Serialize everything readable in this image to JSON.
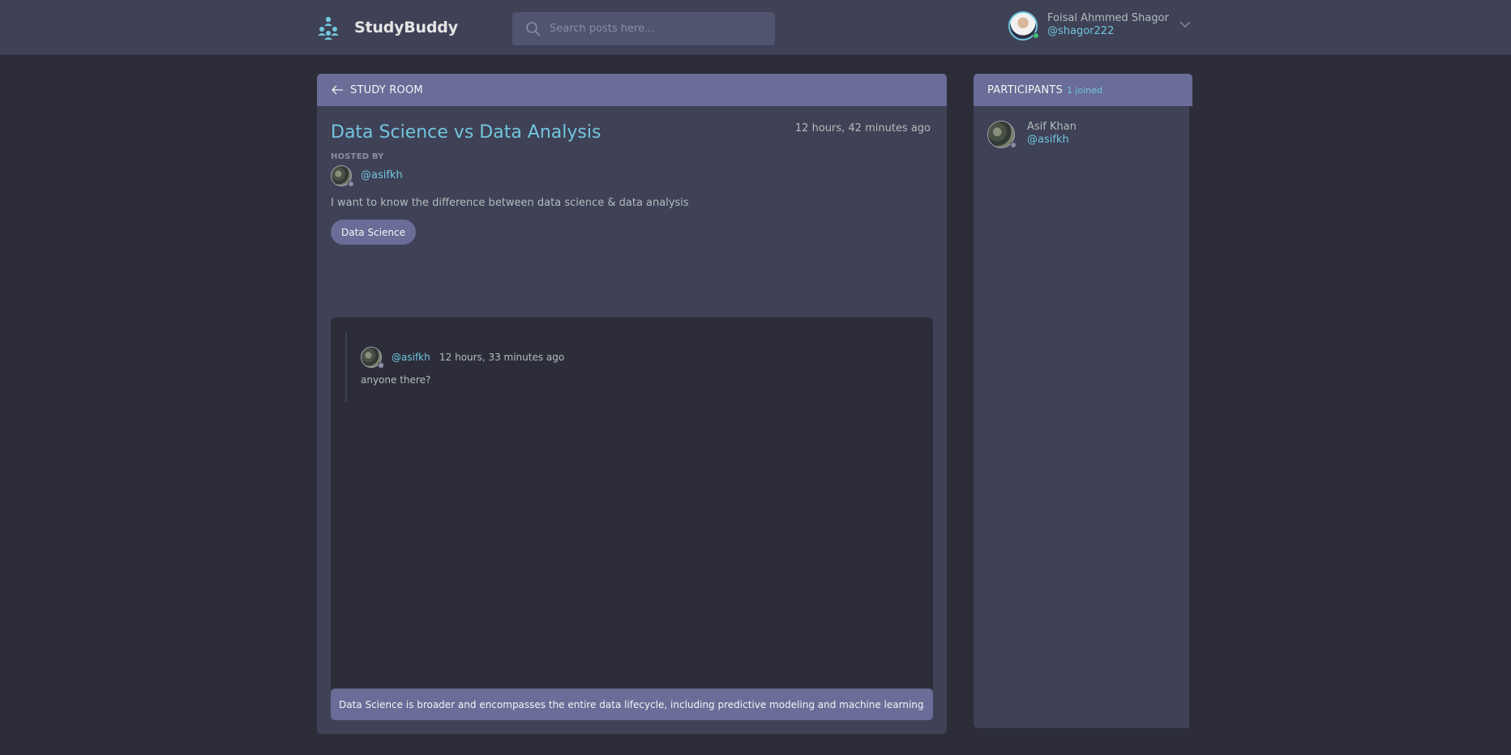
{
  "app": {
    "name": "StudyBuddy"
  },
  "search": {
    "placeholder": "Search posts here..."
  },
  "user": {
    "name": "Foisal Ahmmed Shagor",
    "handle": "@shagor222"
  },
  "room": {
    "header_label": "STUDY ROOM",
    "title": "Data Science vs Data Analysis",
    "time": "12 hours, 42 minutes ago",
    "hosted_by_label": "HOSTED BY",
    "host_handle": "@asifkh",
    "description": "I want to know the difference between data science & data analysis",
    "topic": "Data Science"
  },
  "messages": [
    {
      "handle": "@asifkh",
      "time": "12 hours, 33 minutes ago",
      "body": "anyone there?"
    }
  ],
  "composer": {
    "value": "Data Science is broader and encompasses the entire data lifecycle, including predictive modeling and machine learning. D"
  },
  "participants": {
    "title": "PARTICIPANTS",
    "count": "1 joined",
    "list": [
      {
        "name": "Asif Khan",
        "handle": "@asifkh"
      }
    ]
  },
  "colors": {
    "background": "#2d2d39",
    "panel": "#3f4156",
    "header_accent": "#696d97",
    "link": "#71c6dd",
    "online": "#3ec37a"
  },
  "icons": {
    "logo": "study-group-icon",
    "search": "search-icon",
    "back": "arrow-left-icon",
    "menu": "chevron-down-icon"
  }
}
